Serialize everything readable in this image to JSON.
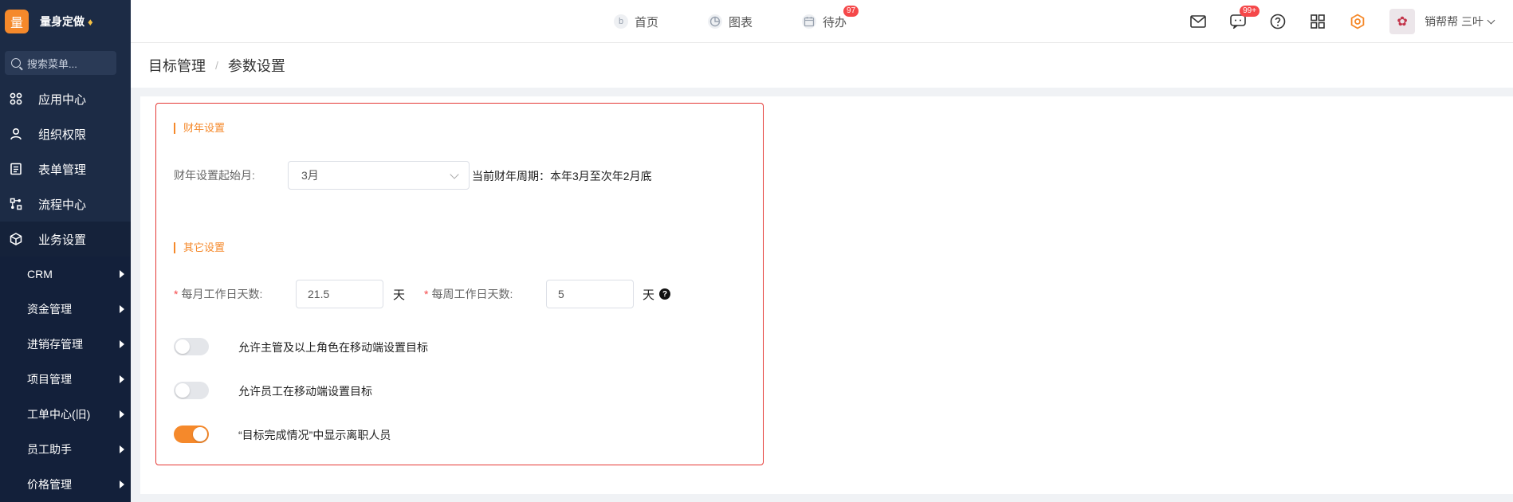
{
  "brand": {
    "logo_char": "量",
    "name": "量身定做",
    "gem": "♦"
  },
  "search": {
    "placeholder": "搜索菜单..."
  },
  "menu": [
    {
      "label": "应用中心",
      "icon": "apps-icon"
    },
    {
      "label": "组织权限",
      "icon": "user-icon"
    },
    {
      "label": "表单管理",
      "icon": "form-icon"
    },
    {
      "label": "流程中心",
      "icon": "flow-icon"
    },
    {
      "label": "业务设置",
      "icon": "cube-icon"
    }
  ],
  "submenu": [
    {
      "label": "CRM"
    },
    {
      "label": "资金管理"
    },
    {
      "label": "进销存管理"
    },
    {
      "label": "项目管理"
    },
    {
      "label": "工单中心(旧)"
    },
    {
      "label": "员工助手"
    },
    {
      "label": "价格管理"
    }
  ],
  "topnav": {
    "home": "首页",
    "chart": "图表",
    "todo": "待办",
    "todo_badge": "97"
  },
  "topright": {
    "msg_badge": "99+",
    "user": "销帮帮 三叶"
  },
  "breadcrumb": {
    "parent": "目标管理",
    "sep": "/",
    "current": "参数设置"
  },
  "fiscal": {
    "section_title": "财年设置",
    "start_label": "财年设置起始月:",
    "start_value": "3月",
    "period_text": "当前财年周期：本年3月至次年2月底"
  },
  "other": {
    "section_title": "其它设置",
    "req_mark": "*",
    "monthly_label": "每月工作日天数:",
    "monthly_value": "21.5",
    "weekly_label": "每周工作日天数:",
    "weekly_value": "5",
    "unit": "天",
    "help": "?",
    "toggles": [
      {
        "label": "允许主管及以上角色在移动端设置目标",
        "on": false
      },
      {
        "label": "允许员工在移动端设置目标",
        "on": false
      },
      {
        "label": "“目标完成情况”中显示离职人员",
        "on": true
      }
    ]
  },
  "colors": {
    "accent": "#f5892b",
    "sidebar": "#1c2b45",
    "badge": "#f5484a",
    "highlight_border": "#e53935"
  }
}
